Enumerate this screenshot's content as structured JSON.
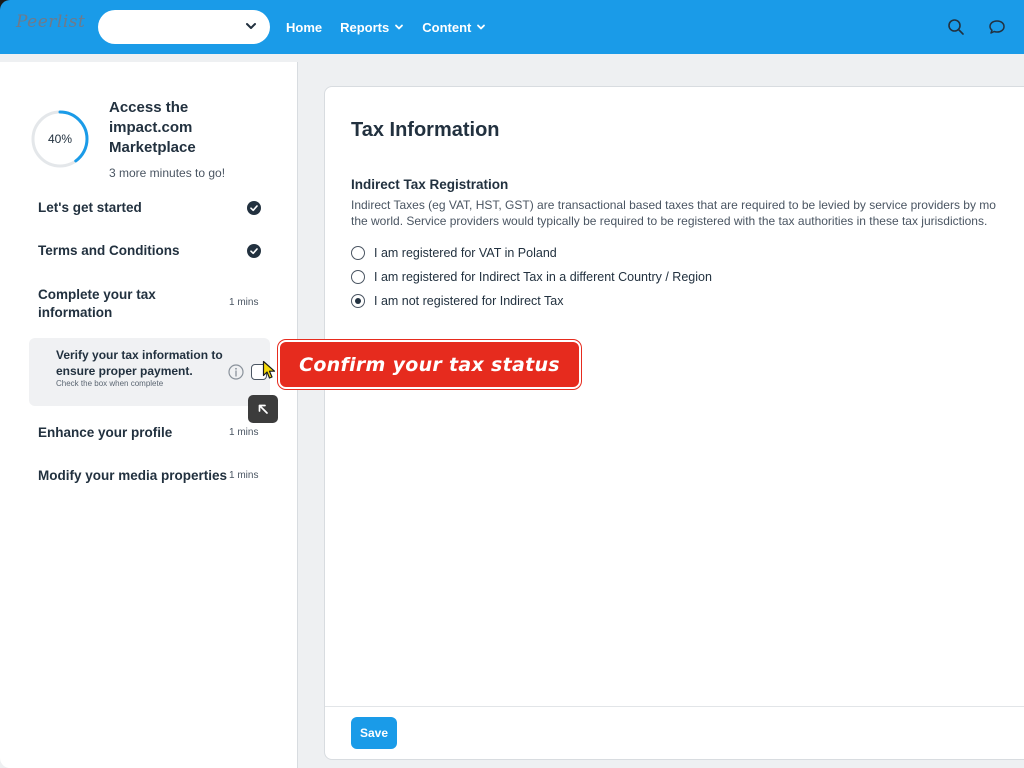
{
  "header": {
    "logo_text": "Peerlist",
    "select_value": "",
    "nav": [
      {
        "label": "Home"
      },
      {
        "label": "Reports"
      },
      {
        "label": "Content"
      }
    ]
  },
  "sidebar": {
    "progress": {
      "percent_label": "40%",
      "value": 0.4
    },
    "title": "Access the impact.com Marketplace",
    "subtitle": "3 more minutes to go!",
    "steps": [
      {
        "label": "Let's get started",
        "status": "complete"
      },
      {
        "label": "Terms and Conditions",
        "status": "complete"
      },
      {
        "label": "Complete your tax information",
        "mins": "1 mins"
      },
      {
        "label": "Enhance your profile",
        "mins": "1 mins"
      },
      {
        "label": "Modify your media properties",
        "mins": "1 mins"
      }
    ],
    "substep": {
      "title": "Verify your tax information to ensure proper payment.",
      "hint": "Check the box when complete",
      "checked": false
    }
  },
  "callout": {
    "text": "Confirm your tax status"
  },
  "main": {
    "title": "Tax Information",
    "section_title": "Indirect Tax Registration",
    "section_desc_1": "Indirect Taxes (eg VAT, HST, GST) are transactional based taxes that are required to be levied by service providers by mo",
    "section_desc_2": "the world. Service providers would typically be required to be registered with the tax authorities in these tax jurisdictions.",
    "options": [
      {
        "label": "I am registered for VAT in Poland",
        "selected": false
      },
      {
        "label": "I am registered for Indirect Tax in a different Country / Region",
        "selected": false
      },
      {
        "label": "I am not registered for Indirect Tax",
        "selected": true
      }
    ],
    "save_label": "Save"
  },
  "colors": {
    "brand": "#1a9be8",
    "callout": "#e62b1e",
    "text": "#22313f"
  }
}
